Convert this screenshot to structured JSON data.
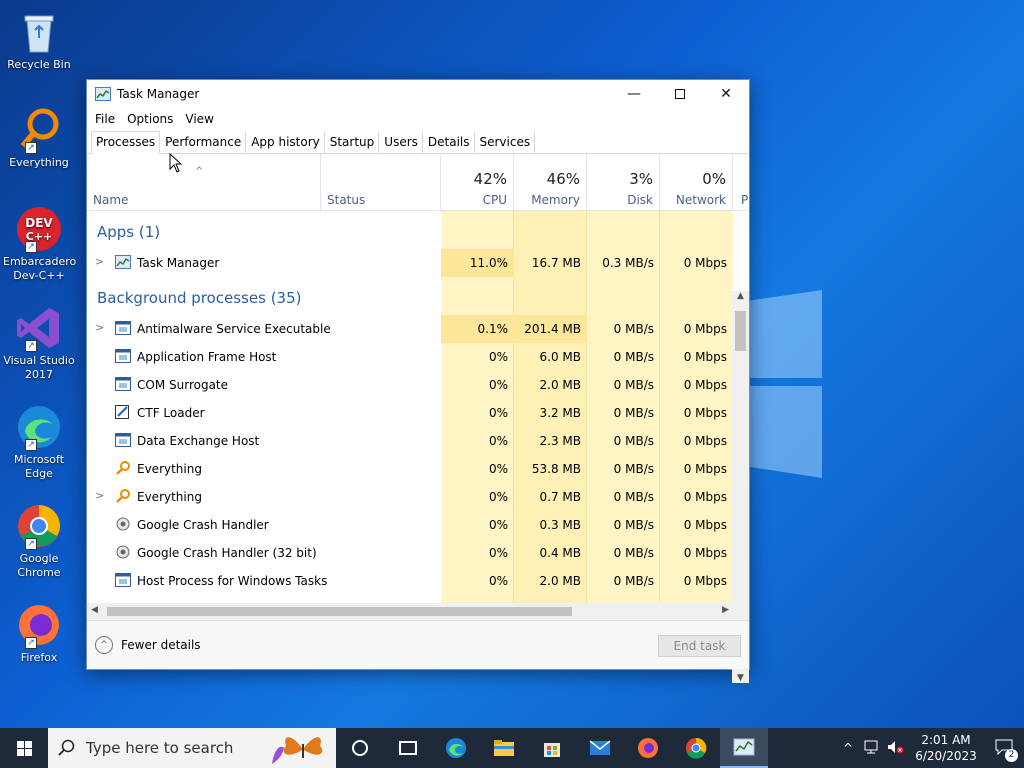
{
  "desktop": {
    "icons": [
      {
        "label": "Recycle Bin",
        "icon": "recycle-bin-icon"
      },
      {
        "label": "Everything",
        "icon": "magnifier-icon"
      },
      {
        "label": "Embarcadero Dev-C++",
        "icon": "dev-cpp-icon"
      },
      {
        "label": "Visual Studio 2017",
        "icon": "visual-studio-icon"
      },
      {
        "label": "Microsoft Edge",
        "icon": "edge-icon"
      },
      {
        "label": "Google Chrome",
        "icon": "chrome-icon"
      },
      {
        "label": "Firefox",
        "icon": "firefox-icon"
      }
    ]
  },
  "window": {
    "title": "Task Manager",
    "menu": [
      "File",
      "Options",
      "View"
    ],
    "tabs": [
      "Processes",
      "Performance",
      "App history",
      "Startup",
      "Users",
      "Details",
      "Services"
    ],
    "active_tab": "Processes",
    "columns": {
      "name": "Name",
      "status": "Status",
      "cpu": {
        "pct": "42%",
        "label": "CPU"
      },
      "memory": {
        "pct": "46%",
        "label": "Memory"
      },
      "disk": {
        "pct": "3%",
        "label": "Disk"
      },
      "network": {
        "pct": "0%",
        "label": "Network"
      },
      "power": "P"
    },
    "groups": {
      "apps": "Apps (1)",
      "background": "Background processes (35)"
    },
    "apps": [
      {
        "name": "Task Manager",
        "cpu": "11.0%",
        "memory": "16.7 MB",
        "disk": "0.3 MB/s",
        "network": "0 Mbps",
        "expand": true,
        "icon": "task-manager-icon"
      }
    ],
    "processes": [
      {
        "name": "Antimalware Service Executable",
        "cpu": "0.1%",
        "memory": "201.4 MB",
        "disk": "0 MB/s",
        "network": "0 Mbps",
        "expand": true,
        "icon": "service-icon"
      },
      {
        "name": "Application Frame Host",
        "cpu": "0%",
        "memory": "6.0 MB",
        "disk": "0 MB/s",
        "network": "0 Mbps",
        "expand": false,
        "icon": "service-icon"
      },
      {
        "name": "COM Surrogate",
        "cpu": "0%",
        "memory": "2.0 MB",
        "disk": "0 MB/s",
        "network": "0 Mbps",
        "expand": false,
        "icon": "service-icon"
      },
      {
        "name": "CTF Loader",
        "cpu": "0%",
        "memory": "3.2 MB",
        "disk": "0 MB/s",
        "network": "0 Mbps",
        "expand": false,
        "icon": "pen-icon"
      },
      {
        "name": "Data Exchange Host",
        "cpu": "0%",
        "memory": "2.3 MB",
        "disk": "0 MB/s",
        "network": "0 Mbps",
        "expand": false,
        "icon": "service-icon"
      },
      {
        "name": "Everything",
        "cpu": "0%",
        "memory": "53.8 MB",
        "disk": "0 MB/s",
        "network": "0 Mbps",
        "expand": false,
        "icon": "magnifier-icon"
      },
      {
        "name": "Everything",
        "cpu": "0%",
        "memory": "0.7 MB",
        "disk": "0 MB/s",
        "network": "0 Mbps",
        "expand": true,
        "icon": "magnifier-icon"
      },
      {
        "name": "Google Crash Handler",
        "cpu": "0%",
        "memory": "0.3 MB",
        "disk": "0 MB/s",
        "network": "0 Mbps",
        "expand": false,
        "icon": "crash-handler-icon"
      },
      {
        "name": "Google Crash Handler (32 bit)",
        "cpu": "0%",
        "memory": "0.4 MB",
        "disk": "0 MB/s",
        "network": "0 Mbps",
        "expand": false,
        "icon": "crash-handler-icon"
      },
      {
        "name": "Host Process for Windows Tasks",
        "cpu": "0%",
        "memory": "2.0 MB",
        "disk": "0 MB/s",
        "network": "0 Mbps",
        "expand": false,
        "icon": "service-icon"
      }
    ],
    "footer": {
      "fewer_details": "Fewer details",
      "end_task": "End task"
    }
  },
  "taskbar": {
    "search_placeholder": "Type here to search",
    "time": "2:01 AM",
    "date": "6/20/2023",
    "notification_count": "2"
  },
  "colors": {
    "cpu_highlight": "#fbe69a",
    "cell_light": "#fff4c4",
    "group_title": "#2a5fa3",
    "taskbar": "#1e2a3a"
  }
}
